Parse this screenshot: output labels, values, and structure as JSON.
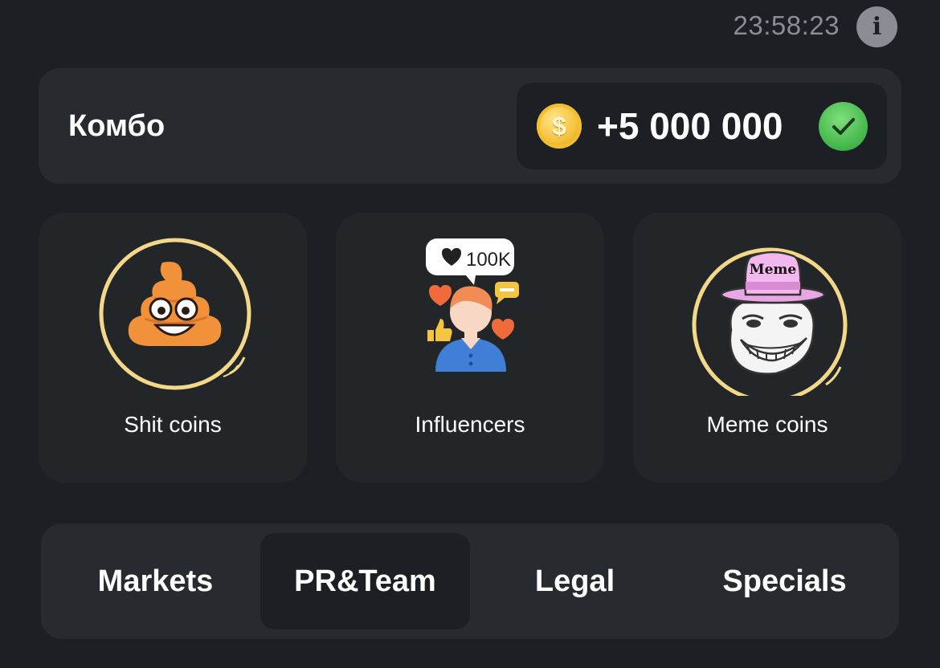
{
  "header": {
    "timer": "23:58:23",
    "info_icon": "info-icon",
    "info_glyph": "i"
  },
  "combo": {
    "title": "Комбо",
    "coin_icon": "coin-icon",
    "coin_glyph": "$",
    "reward": "+5 000 000",
    "check_icon": "check-icon",
    "accent_color": "#62c467"
  },
  "cards": [
    {
      "label": "Shit coins",
      "icon": "poop-icon"
    },
    {
      "label": "Influencers",
      "icon": "influencer-icon",
      "badge": "100K"
    },
    {
      "label": "Meme coins",
      "icon": "troll-face-icon",
      "hat_text": "Meme"
    }
  ],
  "tabs": [
    {
      "label": "Markets",
      "active": false
    },
    {
      "label": "PR&Team",
      "active": true
    },
    {
      "label": "Legal",
      "active": false
    },
    {
      "label": "Specials",
      "active": false
    }
  ]
}
